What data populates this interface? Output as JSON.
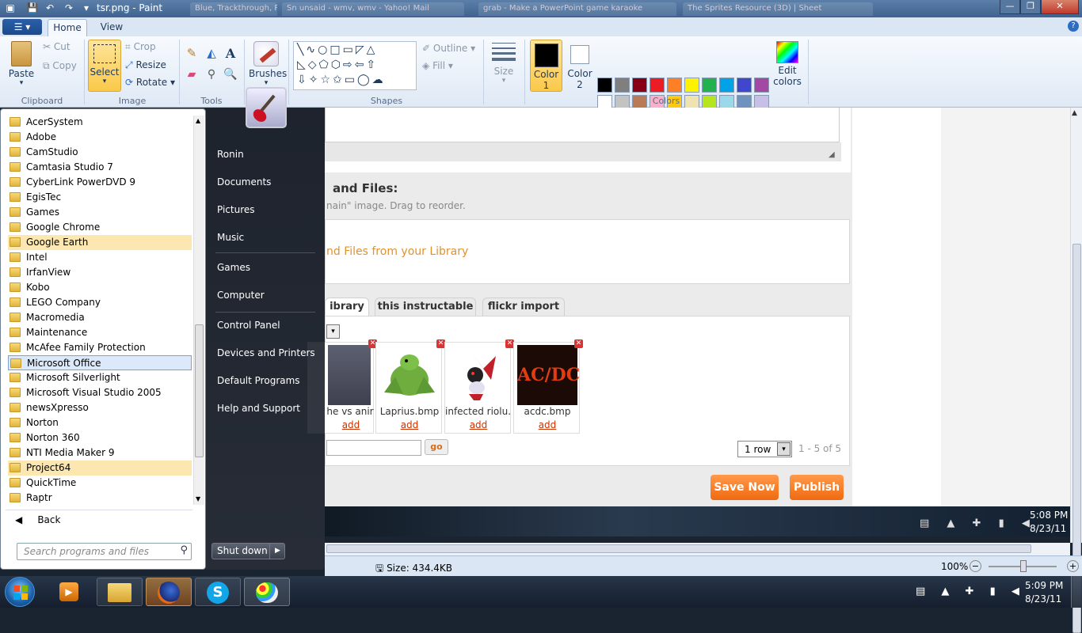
{
  "titlebar": {
    "title": "tsr.png - Paint",
    "bg_tabs": [
      "Blue, Trackthrough, PHO...",
      "Sn unsaid - wmv, wmv - Yahoo! Mail",
      "grab - Make a PowerPoint game karaoke",
      "The Sprites Resource (3D) | Sheet"
    ]
  },
  "ribbon": {
    "tabs": [
      "Home",
      "View"
    ],
    "clipboard": {
      "paste": "Paste",
      "cut": "Cut",
      "copy": "Copy",
      "label": "Clipboard"
    },
    "image": {
      "select": "Select",
      "crop": "Crop",
      "resize": "Resize",
      "rotate": "Rotate",
      "label": "Image"
    },
    "tools": {
      "label": "Tools"
    },
    "brushes": {
      "label": "Brushes"
    },
    "shapes": {
      "outline": "Outline",
      "fill": "Fill",
      "label": "Shapes"
    },
    "size": {
      "label": "Size"
    },
    "colors": {
      "color1": "Color",
      "color1_num": "1",
      "color2": "Color",
      "color2_num": "2",
      "edit": "Edit",
      "edit2": "colors",
      "label": "Colors",
      "row1": [
        "#000000",
        "#7f7f7f",
        "#880015",
        "#ed1c24",
        "#ff7f27",
        "#fff200",
        "#22b14c",
        "#00a2e8",
        "#3f48cc",
        "#a349a4"
      ],
      "row2": [
        "#ffffff",
        "#c3c3c3",
        "#b97a57",
        "#ffaec9",
        "#ffc90e",
        "#efe4b0",
        "#b5e61d",
        "#99d9ea",
        "#7092be",
        "#c8bfe7"
      ]
    }
  },
  "webpage": {
    "section_title": "and Files:",
    "section_sub": "nain\" image. Drag to reorder.",
    "library_link": "nd Files from your Library",
    "tabs": [
      "ibrary",
      "this instructable",
      "flickr import"
    ],
    "thumbs": [
      {
        "caption": "he vs anir",
        "add": "add"
      },
      {
        "caption": "Laprius.bmp",
        "add": "add"
      },
      {
        "caption": "infected riolu.l",
        "add": "add"
      },
      {
        "caption": "acdc.bmp",
        "add": "add"
      }
    ],
    "go": "go",
    "rows_select": "1 row",
    "count": "1 - 5 of 5",
    "save_now": "Save Now",
    "publish": "Publish",
    "acdc_logo": "AC/DC"
  },
  "inner_taskbar": {
    "time": "5:08 PM",
    "date": "8/23/11"
  },
  "status": {
    "size": "Size: 434.4KB",
    "zoom": "100%"
  },
  "start_menu": {
    "programs": [
      "AcerSystem",
      "Adobe",
      "CamStudio",
      "Camtasia Studio 7",
      "CyberLink PowerDVD 9",
      "EgisTec",
      "Games",
      "Google Chrome",
      "Google Earth",
      "Intel",
      "IrfanView",
      "Kobo",
      "LEGO Company",
      "Macromedia",
      "Maintenance",
      "McAfee Family Protection",
      "Microsoft Office",
      "Microsoft Silverlight",
      "Microsoft Visual Studio 2005",
      "newsXpresso",
      "Norton",
      "Norton 360",
      "NTI Media Maker 9",
      "Project64",
      "QuickTime",
      "Raptr"
    ],
    "back": "Back",
    "search_placeholder": "Search programs and files",
    "right_links": [
      "Ronin",
      "Documents",
      "Pictures",
      "Music",
      "Games",
      "Computer",
      "Control Panel",
      "Devices and Printers",
      "Default Programs",
      "Help and Support"
    ],
    "shutdown": "Shut down"
  },
  "taskbar": {
    "time": "5:09 PM",
    "date": "8/23/11"
  }
}
